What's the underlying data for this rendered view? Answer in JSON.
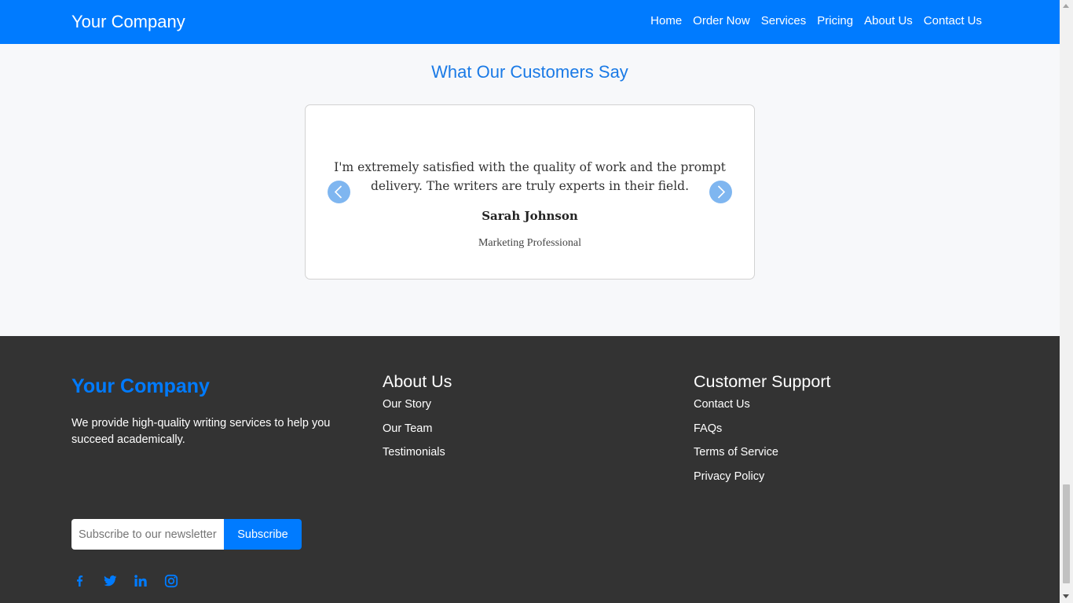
{
  "header": {
    "brand": "Your Company",
    "nav": [
      "Home",
      "Order Now",
      "Services",
      "Pricing",
      "About Us",
      "Contact Us"
    ]
  },
  "testimonials": {
    "title": "What Our Customers Say",
    "quote": "I'm extremely satisfied with the quality of work and the prompt delivery. The writers are truly experts in their field.",
    "name": "Sarah Johnson",
    "role": "Marketing Professional",
    "prev_icon": "chevron-left-icon",
    "next_icon": "chevron-right-icon"
  },
  "footer": {
    "brand": "Your Company",
    "description": "We provide high-quality writing services to help you succeed academically.",
    "about": {
      "heading": "About Us",
      "links": [
        "Our Story",
        "Our Team",
        "Testimonials"
      ]
    },
    "support": {
      "heading": "Customer Support",
      "links": [
        "Contact Us",
        "FAQs",
        "Terms of Service",
        "Privacy Policy"
      ]
    },
    "newsletter": {
      "placeholder": "Subscribe to our newsletter",
      "button": "Subscribe"
    },
    "social": [
      "facebook-icon",
      "twitter-icon",
      "linkedin-icon",
      "instagram-icon"
    ]
  },
  "colors": {
    "primary": "#007bff",
    "footer_bg": "#333333",
    "page_bg": "#f7f8fa",
    "arrow": "#7fb6f0"
  }
}
